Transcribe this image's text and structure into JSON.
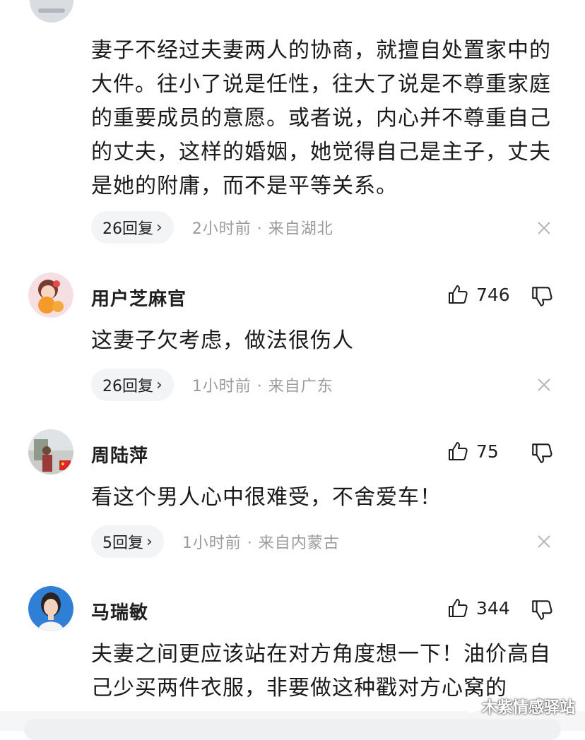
{
  "top_comment": {
    "text": "妻子不经过夫妻两人的协商，就擅自处置家中的大件。往小了说是任性，往大了说是不尊重家庭的重要成员的意愿。或者说，内心并不尊重自己的丈夫，这样的婚姻，她觉得自己是主子，丈夫是她的附庸，而不是平等关系。",
    "reply_label": "26回复",
    "meta": "2小时前 · 来自湖北"
  },
  "comments": [
    {
      "username": "用户芝麻官",
      "likes": "746",
      "text": "这妻子欠考虑，做法很伤人",
      "reply_label": "26回复",
      "meta": "1小时前 · 来自广东"
    },
    {
      "username": "周陆萍",
      "likes": "75",
      "text": "看这个男人心中很难受，不舍爱车！",
      "reply_label": "5回复",
      "meta": "1小时前 · 来自内蒙古"
    },
    {
      "username": "马瑞敏",
      "likes": "344",
      "text": "夫妻之间更应该站在对方角度想一下！油价高自己少买两件衣服，非要做这种戳对方心窝的"
    }
  ],
  "watermark": "木紫情感驿站",
  "icons": {
    "like": "thumbs-up-icon",
    "dislike": "thumbs-down-icon",
    "close": "close-icon",
    "chevron": "chevron-right-icon"
  },
  "colors": {
    "meta_gray": "#9a9a9a",
    "pill_bg": "#f3f4f6"
  }
}
